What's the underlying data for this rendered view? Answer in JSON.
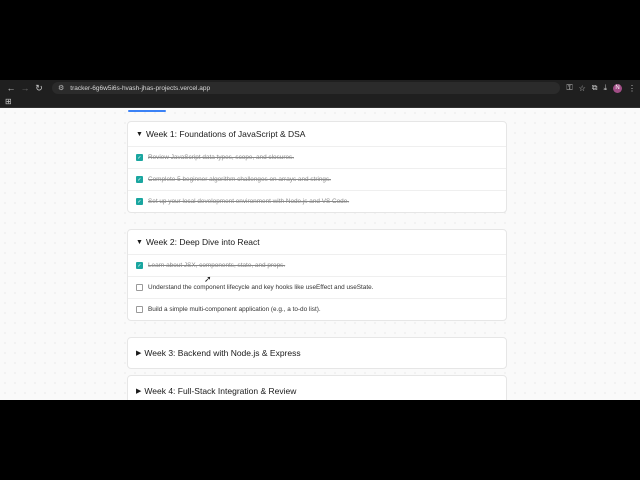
{
  "browser": {
    "url": "tracker-6g6w5i6s-hvash-jhas-projects.vercel.app",
    "profile_initial": "N"
  },
  "weeks": [
    {
      "title": "Week 1: Foundations of JavaScript & DSA",
      "expanded": true,
      "tasks": [
        {
          "label": "Review JavaScript data types, scope, and closures.",
          "done": true
        },
        {
          "label": "Complete 5 beginner algorithm challenges on arrays and strings.",
          "done": true
        },
        {
          "label": "Set up your local development environment with Node.js and VS Code.",
          "done": true
        }
      ]
    },
    {
      "title": "Week 2: Deep Dive into React",
      "expanded": true,
      "tasks": [
        {
          "label": "Learn about JSX, components, state, and props.",
          "done": true
        },
        {
          "label": "Understand the component lifecycle and key hooks like useEffect and useState.",
          "done": false
        },
        {
          "label": "Build a simple multi-component application (e.g., a to-do list).",
          "done": false
        }
      ]
    },
    {
      "title": "Week 3: Backend with Node.js & Express",
      "expanded": false,
      "tasks": []
    },
    {
      "title": "Week 4: Full-Stack Integration & Review",
      "expanded": false,
      "tasks": []
    }
  ]
}
